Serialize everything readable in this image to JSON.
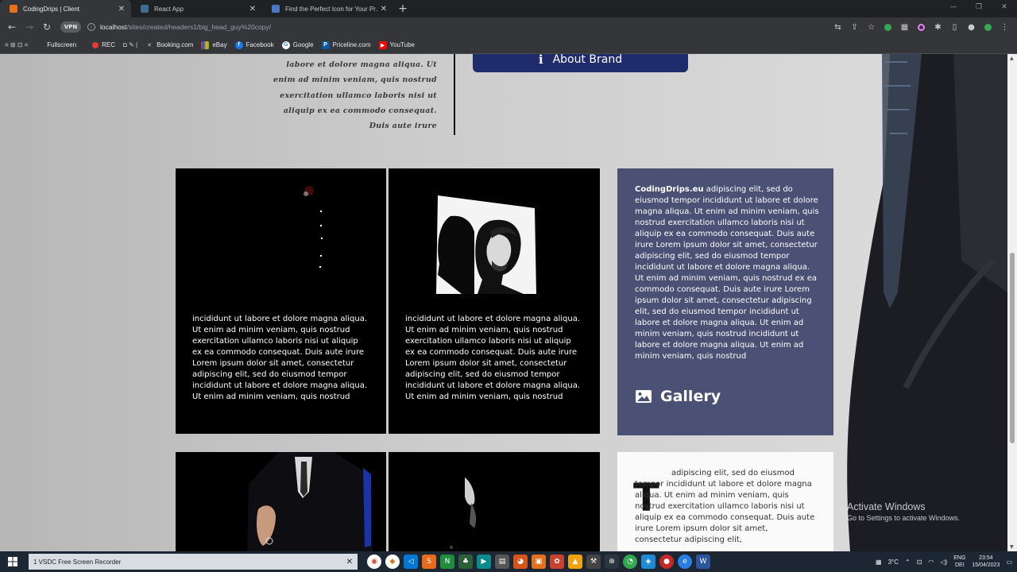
{
  "browser": {
    "tabs": [
      {
        "title": "CodingDrips | Client",
        "active": true,
        "favicon_color": "#e8711a",
        "close": "✕"
      },
      {
        "title": "React App",
        "active": false,
        "favicon_color": "#3c6f8f",
        "close": "✕"
      },
      {
        "title": "Find the Perfect Icon for Your Pr…",
        "active": false,
        "favicon_color": "#4a78c2",
        "close": "✕"
      }
    ],
    "new_tab": "+",
    "url_host": "localhost",
    "url_path": "/sites/created/headers1/big_head_guy%20copy/",
    "vpn_label": "VPN"
  },
  "bookmarks": [
    {
      "label": "Fullscreen",
      "icon": "grid-icon"
    },
    {
      "label": "REC",
      "icon": "record-icon"
    },
    {
      "label": "Booking.com",
      "icon": "booking-icon"
    },
    {
      "label": "eBay",
      "icon": "ebay-icon"
    },
    {
      "label": "Facebook",
      "icon": "facebook-icon"
    },
    {
      "label": "Google",
      "icon": "google-icon"
    },
    {
      "label": "Priceline.com",
      "icon": "priceline-icon"
    },
    {
      "label": "YouTube",
      "icon": "youtube-icon"
    }
  ],
  "page": {
    "script_text": [
      "labore et dolore magna aliqua. Ut",
      "enim ad minim veniam, quis nostrud",
      "exercitation ullamco laboris nisi ut",
      "aliquip ex ea commodo consequat.",
      "Duis aute irure"
    ],
    "about_button": "About Brand",
    "card_text": "incididunt ut labore et dolore magna aliqua. Ut enim ad minim veniam, quis nostrud exercitation ullamco laboris nisi ut aliquip ex ea commodo consequat. Duis aute irure Lorem ipsum dolor sit amet, consectetur adipiscing elit, sed do eiusmod tempor incididunt ut labore et dolore magna aliqua. Ut enim ad minim veniam, quis nostrud",
    "brand_name": "CodingDrips.eu",
    "blue_text": " adipiscing elit, sed do eiusmod tempor incididunt ut labore et dolore magna aliqua. Ut enim ad minim veniam, quis nostrud exercitation ullamco laboris nisi ut aliquip ex ea commodo consequat. Duis aute irure Lorem ipsum dolor sit amet, consectetur adipiscing elit, sed do eiusmod tempor incididunt ut labore et dolore magna aliqua. Ut enim ad minim veniam, quis nostrud ex ea commodo consequat. Duis aute irure Lorem ipsum dolor sit amet, consectetur adipiscing elit, sed do eiusmod tempor incididunt ut labore et dolore magna aliqua. Ut enim ad minim veniam, quis nostrud incididunt ut labore et dolore magna aliqua. Ut enim ad minim veniam, quis nostrud",
    "gallery_label": "Gallery",
    "dropcap": "T",
    "white_text": "adipiscing elit, sed do eiusmod tempor incididunt ut labore et dolore magna aliqua. Ut enim ad minim veniam, quis nostrud exercitation ullamco laboris nisi ut aliquip ex ea commodo consequat. Duis aute irure Lorem ipsum dolor sit amet, consectetur adipiscing elit,"
  },
  "watermark": {
    "line1": "Activate Windows",
    "line2": "Go to Settings to activate Windows."
  },
  "taskbar": {
    "recorder_label": "1  VSDC Free Screen Recorder",
    "temperature": "3°C",
    "lang_top": "ENG",
    "lang_bottom": "DEI",
    "time": "23:54",
    "date": "15/04/2023"
  },
  "colors": {
    "brand_blue": "#1f2c6b",
    "card_blue": "#4a5175"
  }
}
